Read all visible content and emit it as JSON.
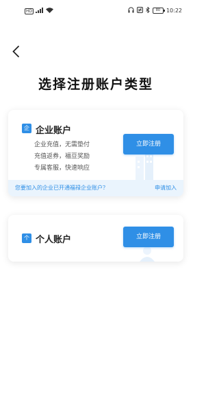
{
  "status_bar": {
    "left_icons": [
      "hd-badge",
      "signal-icon",
      "wifi-icon"
    ],
    "hd_label": "HD",
    "right_icons": [
      "headphones-icon",
      "nfc-icon",
      "bluetooth-icon",
      "battery-icon"
    ],
    "battery": "80",
    "time": "10:22"
  },
  "header": {
    "back_icon": "chevron-left-icon",
    "title": "选择注册账户类型"
  },
  "cards": [
    {
      "icon_glyph": "企",
      "title": "企业账户",
      "desc": [
        "企业充值，无需垫付",
        "充值返券，福豆奖励",
        "专属客服，快速响应"
      ],
      "button_label": "立即注册",
      "footer_question": "您要加入的企业已开通福禄企业账户？",
      "footer_link": "申请加入"
    },
    {
      "icon_glyph": "个",
      "title": "个人账户",
      "button_label": "立即注册"
    }
  ],
  "colors": {
    "accent": "#2f8fe6",
    "footer_bg": "#eaf4fd"
  }
}
